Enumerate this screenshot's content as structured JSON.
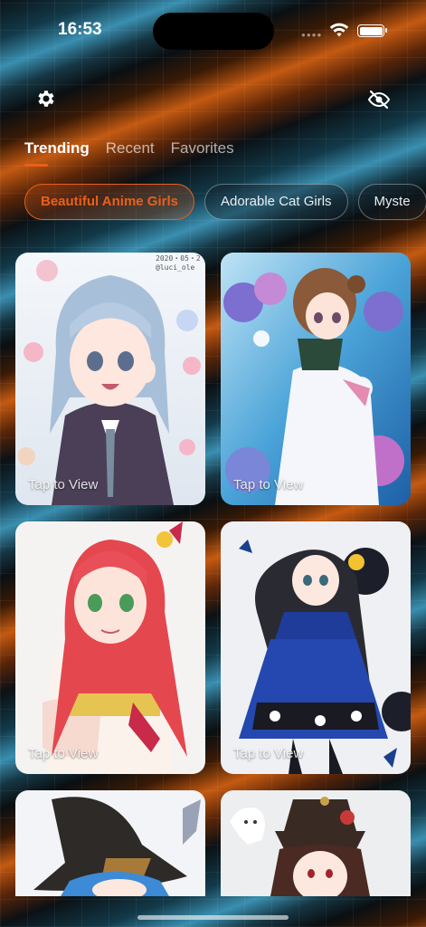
{
  "status_bar": {
    "time": "16:53"
  },
  "header": {
    "settings_icon": "gear-icon",
    "visibility_icon": "eye-off-icon"
  },
  "tabs": [
    {
      "label": "Trending",
      "active": true
    },
    {
      "label": "Recent",
      "active": false
    },
    {
      "label": "Favorites",
      "active": false
    }
  ],
  "categories": [
    {
      "label": "Beautiful Anime Girls",
      "active": true
    },
    {
      "label": "Adorable Cat Girls",
      "active": false
    },
    {
      "label": "Myste",
      "active": false
    }
  ],
  "colors": {
    "accent": "#e8601c"
  },
  "cards": [
    {
      "tap_label": "Tap to View",
      "watermark": "2020・05・2\n@luci_ole"
    },
    {
      "tap_label": "Tap to View"
    },
    {
      "tap_label": "Tap to View"
    },
    {
      "tap_label": "Tap to View"
    },
    {
      "tap_label": ""
    },
    {
      "tap_label": ""
    }
  ]
}
